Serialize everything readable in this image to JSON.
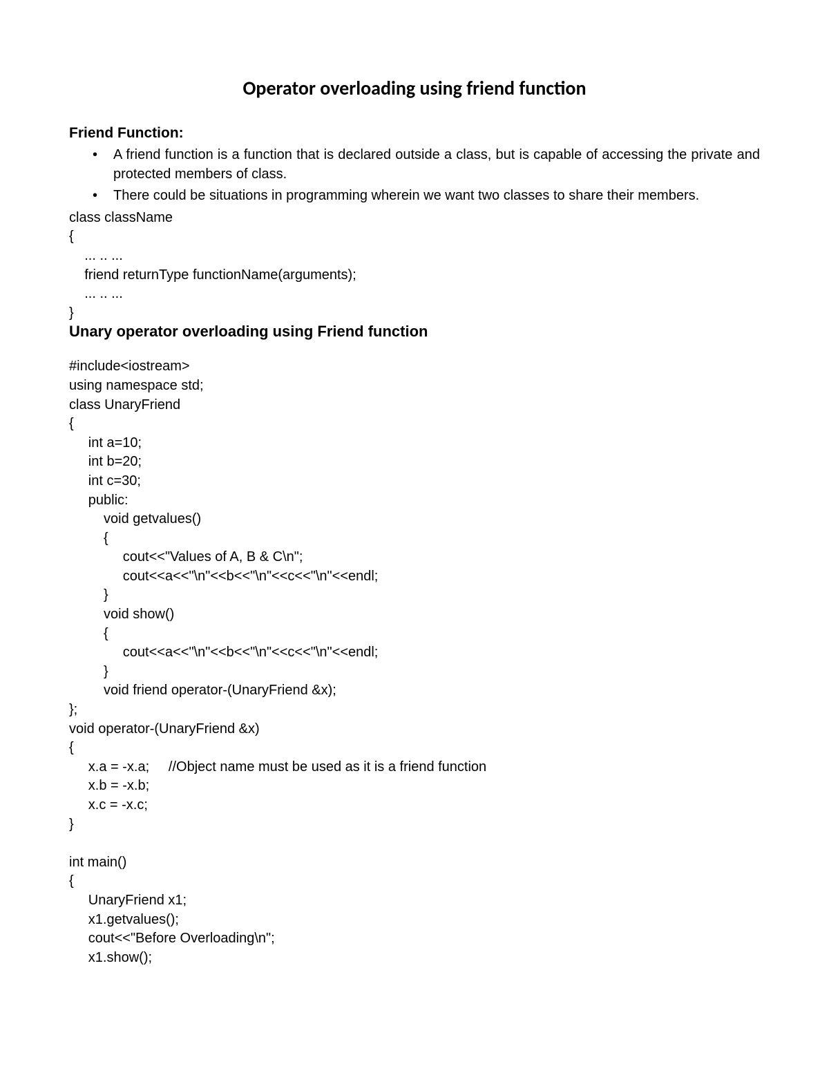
{
  "title": "Operator overloading using friend function",
  "section1": {
    "heading": "Friend Function:",
    "bullet1": "A friend function is a function that is declared outside a class, but is capable of accessing the private and protected members of class.",
    "bullet2": "There could be situations in programming wherein we want two classes to share their members."
  },
  "code1": "class className\n{\n    ... .. ...\n    friend returnType functionName(arguments);\n    ... .. ...\n}",
  "section2": {
    "heading": "Unary operator overloading using Friend function"
  },
  "code2": "#include<iostream>\nusing namespace std;\nclass UnaryFriend\n{\n     int a=10;\n     int b=20;\n     int c=30;\n     public:\n         void getvalues()\n         {\n              cout<<\"Values of A, B & C\\n\";\n              cout<<a<<\"\\n\"<<b<<\"\\n\"<<c<<\"\\n\"<<endl;\n         }\n         void show()\n         {\n              cout<<a<<\"\\n\"<<b<<\"\\n\"<<c<<\"\\n\"<<endl;\n         }\n         void friend operator-(UnaryFriend &x);\n};\nvoid operator-(UnaryFriend &x)\n{\n     x.a = -x.a;     //Object name must be used as it is a friend function\n     x.b = -x.b;\n     x.c = -x.c;\n}\n\nint main()\n{\n     UnaryFriend x1;\n     x1.getvalues();\n     cout<<\"Before Overloading\\n\";\n     x1.show();"
}
